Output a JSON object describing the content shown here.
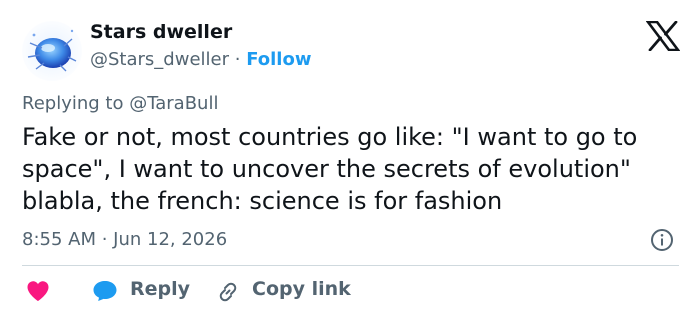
{
  "author": {
    "name": "Stars dweller",
    "handle": "@Stars_dweller",
    "separator": "·",
    "follow_label": "Follow"
  },
  "reply": {
    "prefix": "Replying to",
    "mention": "@TaraBull"
  },
  "tweet": {
    "text": "Fake or not, most countries go like: \"I want to go to space\", I want to uncover the secrets of evolution\" blabla, the french: science is for fashion",
    "timestamp": "8:55 AM · Jun 12, 2026"
  },
  "actions": {
    "reply_label": "Reply",
    "copy_label": "Copy link"
  },
  "icons": {
    "brand": "x-logo-icon",
    "info": "info-icon",
    "like": "heart-icon",
    "reply": "speech-bubble-icon",
    "copy": "link-icon"
  },
  "colors": {
    "text": "#0f1419",
    "secondary": "#536471",
    "accent": "#1d9bf0",
    "like": "#f91880",
    "divider": "#cfd9de"
  }
}
